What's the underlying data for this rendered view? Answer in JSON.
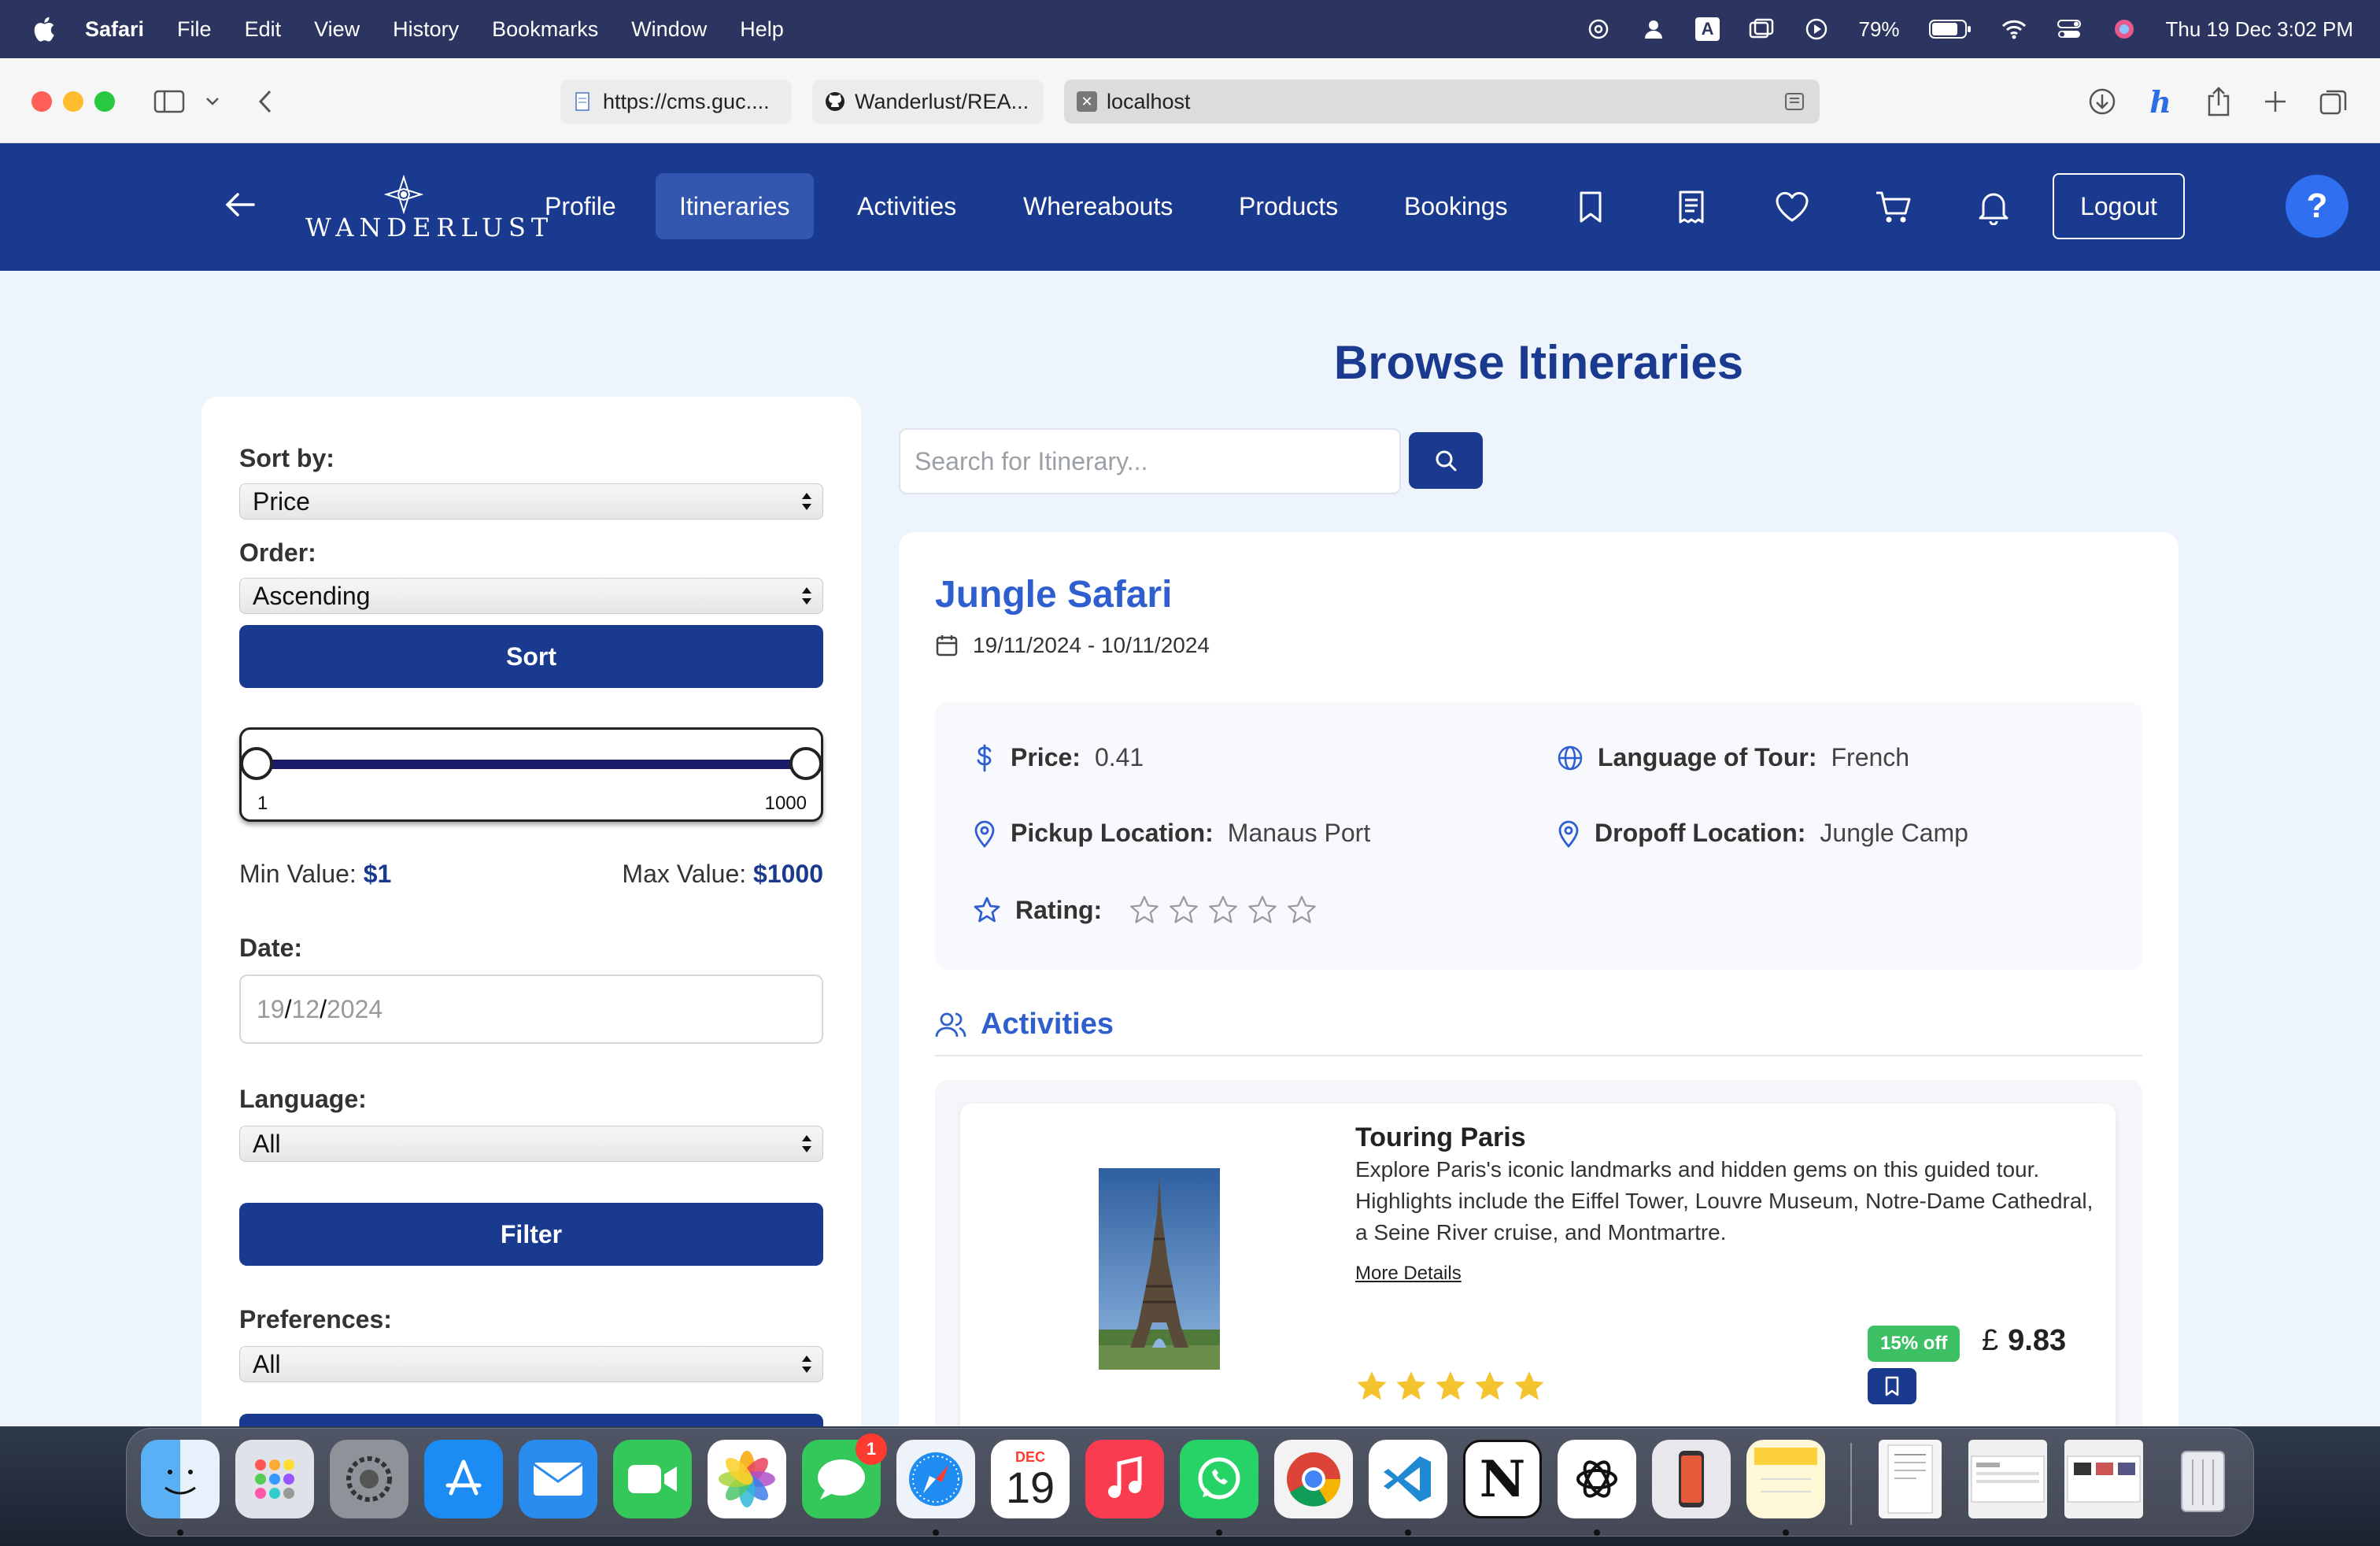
{
  "menubar": {
    "app": "Safari",
    "items": [
      "File",
      "Edit",
      "View",
      "History",
      "Bookmarks",
      "Window",
      "Help"
    ],
    "input_source": "A",
    "battery": "79%",
    "datetime": "Thu 19 Dec  3:02 PM"
  },
  "browser": {
    "tabs": [
      {
        "label": "https://cms.guc....",
        "icon": "document-icon"
      },
      {
        "label": "Wanderlust/REA...",
        "icon": "github-icon"
      },
      {
        "label": "localhost",
        "icon": "close-icon"
      }
    ]
  },
  "appnav": {
    "brand": "WANDERLUST",
    "links": [
      "Profile",
      "Itineraries",
      "Activities",
      "Whereabouts",
      "Products",
      "Bookings"
    ],
    "active": "Itineraries",
    "icons": [
      "bookmark-icon",
      "receipt-icon",
      "heart-icon",
      "cart-icon",
      "bell-icon"
    ],
    "logout": "Logout",
    "help": "?"
  },
  "page": {
    "title": "Browse Itineraries",
    "search_placeholder": "Search for Itinerary..."
  },
  "sidebar": {
    "sort_by_label": "Sort by:",
    "sort_by_value": "Price",
    "order_label": "Order:",
    "order_value": "Ascending",
    "sort_button": "Sort",
    "range_min_label": "1",
    "range_max_label": "1000",
    "min_value_label": "Min Value:",
    "min_value": "$1",
    "max_value_label": "Max Value:",
    "max_value": "$1000",
    "date_label": "Date:",
    "date_day": "19",
    "date_month": "12",
    "date_year": "2024",
    "language_label": "Language:",
    "language_value": "All",
    "filter_button": "Filter",
    "preferences_label": "Preferences:",
    "preferences_value": "All"
  },
  "itinerary": {
    "title": "Jungle Safari",
    "dates": "19/11/2024 - 10/11/2024",
    "price_label": "Price:",
    "price": "0.41",
    "language_label": "Language of Tour:",
    "language": "French",
    "pickup_label": "Pickup Location:",
    "pickup": "Manaus Port",
    "dropoff_label": "Dropoff Location:",
    "dropoff": "Jungle Camp",
    "rating_label": "Rating:",
    "rating": 0,
    "rating_max": 5,
    "activities_heading": "Activities"
  },
  "activity": {
    "title": "Touring Paris",
    "description": "Explore Paris's iconic landmarks and hidden gems on this guided tour. Highlights include the Eiffel Tower, Louvre Museum, Notre-Dame Cathedral, a Seine River cruise, and Montmartre.",
    "more_details": "More Details",
    "discount": "15% off",
    "currency": "£",
    "price": "9.83",
    "rating": 5
  },
  "dock": {
    "apps": [
      "Finder",
      "Launchpad",
      "System Settings",
      "App Store",
      "Mail",
      "FaceTime",
      "Photos",
      "Messages",
      "Safari",
      "Calendar",
      "Music",
      "WhatsApp",
      "Chrome",
      "VS Code",
      "Notion",
      "ChatGPT",
      "iPhone Mirroring",
      "Notes"
    ],
    "messages_badge": "1",
    "calendar_month": "DEC",
    "calendar_day": "19"
  },
  "colors": {
    "brand_navy": "#1a3a8f",
    "accent_blue": "#2f5fcf",
    "discount_green": "#3dbf64",
    "star_gold": "#f4c430"
  }
}
